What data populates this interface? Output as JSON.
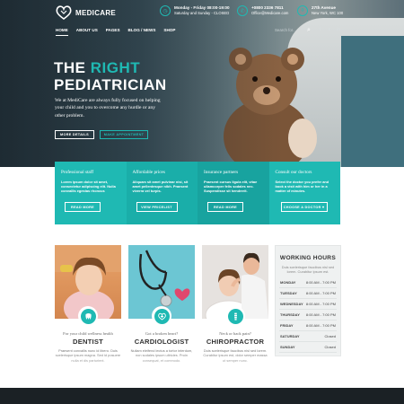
{
  "brand": {
    "name": "MEDICARE",
    "accent": "#1fb9b3"
  },
  "topbar": {
    "hours": {
      "title": "Monday - Friday 08:00-19:00",
      "sub": "Saturday and Sunday - CLOSED"
    },
    "phone": {
      "title": "+0800 2336 7811",
      "sub": "Office@Medicare.com"
    },
    "address": {
      "title": "27th Avenue",
      "sub": "New York, WC 100"
    }
  },
  "nav": {
    "items": [
      "HOME",
      "ABOUT US",
      "PAGES",
      "BLOG / NEWS",
      "SHOP"
    ],
    "search_placeholder": "Search for...",
    "social": [
      "f",
      "t",
      "in"
    ]
  },
  "hero": {
    "headline_1a": "THE ",
    "headline_1b": "RIGHT",
    "headline_2": "PEDIATRICIAN",
    "desc": "We at MediCare are always fully focused on helping your child and you to overcome any hurdle or any other problem.",
    "btn_more": "MORE DETAILS",
    "btn_appointment": "MAKE APPOINTMENT"
  },
  "cards": [
    {
      "title": "Professional staff",
      "text": "Lorem ipsum dolor sit amet, consectetur adipiscing elit. Nulla convallis egestas rhoncus",
      "button": "READ MORE"
    },
    {
      "title": "Affordable prices",
      "text": "Aliquam sit amet pulvinar nisi, sit amet pellentesque nibh. Praesent viverra vel turpis.",
      "button": "VIEW PRICELIST"
    },
    {
      "title": "Insurance partners",
      "text": "Praesent cursus ligula elit, vitae ullamcorper felis sodales nec. Suspendisse sit hendrerit.",
      "button": "READ MORE"
    },
    {
      "title": "Consult our doctors",
      "text": "Select the doctor you prefer and book a visit with him or her in a matter of minutes.",
      "button": "CHOOSE A DOCTOR"
    }
  ],
  "doctors": [
    {
      "sub": "For your child wellness health",
      "name": "DENTIST",
      "desc": "Praesent convallis nunc id libero. Duis scelerisque ipsum magna. Sed id posuere nulla et dis parturient."
    },
    {
      "sub": "Got a broken heart?",
      "name": "CARDIOLOGIST",
      "desc": "Nullam eleifend lectus a tortor interdum, non sodales ipsum ultricies. Proin consequat, et commodo."
    },
    {
      "sub": "Neck or back pain?",
      "name": "CHIROPRACTOR",
      "desc": "Duis scelerisque faucibus nisl sed lorem. Curabitur ipsum est, dolor semper massa ut semper nunc."
    }
  ],
  "hours": {
    "title": "WORKING HOURS",
    "desc": "Duis scelerisque faucibus nisl sed lorem. Curabitur ipsum est.",
    "rows": [
      {
        "day": "MONDAY",
        "time": "8:00 AM - 7:00 PM"
      },
      {
        "day": "TUESDAY",
        "time": "8:00 AM - 7:00 PM"
      },
      {
        "day": "WEDNESDAY",
        "time": "8:00 AM - 7:00 PM"
      },
      {
        "day": "THURSDAY",
        "time": "8:00 AM - 7:00 PM"
      },
      {
        "day": "FRIDAY",
        "time": "8:00 AM - 7:00 PM"
      },
      {
        "day": "SATURDAY",
        "time": "Closed"
      },
      {
        "day": "SUNDAY",
        "time": "Closed"
      }
    ]
  }
}
